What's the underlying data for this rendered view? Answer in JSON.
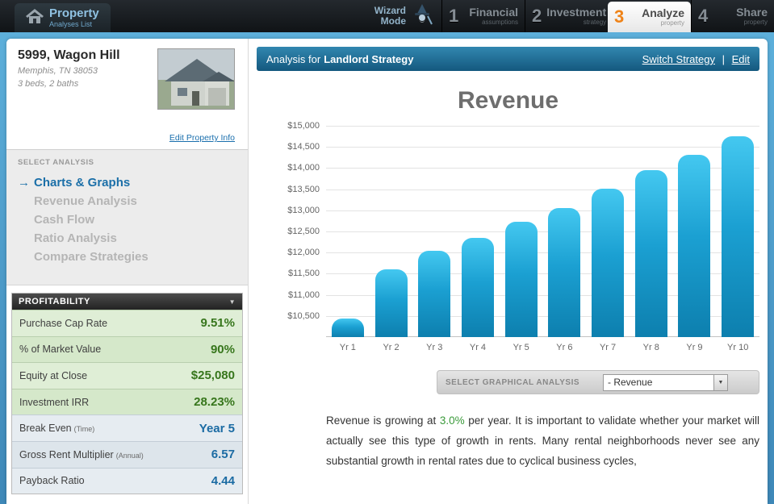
{
  "topbar": {
    "property_tab": {
      "label": "Property",
      "sublabel": "Analyses List"
    },
    "wizard_line1": "Wizard",
    "wizard_line2": "Mode",
    "steps": [
      {
        "num": "1",
        "label": "Financial",
        "sublabel": "assumptions",
        "active": false
      },
      {
        "num": "2",
        "label": "Investment",
        "sublabel": "strategy",
        "active": false
      },
      {
        "num": "3",
        "label": "Analyze",
        "sublabel": "property",
        "active": true
      },
      {
        "num": "4",
        "label": "Share",
        "sublabel": "property",
        "active": false
      }
    ]
  },
  "sidebar": {
    "property": {
      "title": "5999, Wagon Hill",
      "address": "Memphis, TN 38053",
      "details": "3 beds, 2 baths",
      "edit_link": "Edit Property Info"
    },
    "select_analysis": {
      "header": "SELECT ANALYSIS",
      "arrow": "→",
      "items": [
        {
          "label": "Charts & Graphs",
          "active": true
        },
        {
          "label": "Revenue Analysis",
          "active": false
        },
        {
          "label": "Cash Flow",
          "active": false
        },
        {
          "label": "Ratio Analysis",
          "active": false
        },
        {
          "label": "Compare Strategies",
          "active": false
        }
      ]
    },
    "profitability": {
      "header": "PROFITABILITY",
      "caret": "▼",
      "rows": [
        {
          "label": "Purchase Cap Rate",
          "sublabel": "",
          "value": "9.51%",
          "style": "green"
        },
        {
          "label": "% of Market Value",
          "sublabel": "",
          "value": "90%",
          "style": "green"
        },
        {
          "label": "Equity at Close",
          "sublabel": "",
          "value": "$25,080",
          "style": "green"
        },
        {
          "label": "Investment IRR",
          "sublabel": "",
          "value": "28.23%",
          "style": "green"
        },
        {
          "label": "Break Even",
          "sublabel": "(Time)",
          "value": "Year 5",
          "style": "blue"
        },
        {
          "label": "Gross Rent Multiplier",
          "sublabel": "(Annual)",
          "value": "6.57",
          "style": "blue"
        },
        {
          "label": "Payback Ratio",
          "sublabel": "",
          "value": "4.44",
          "style": "blue"
        }
      ]
    }
  },
  "main": {
    "header": {
      "prefix": "Analysis for ",
      "strategy": "Landlord Strategy",
      "switch_link": "Switch Strategy",
      "separator": "|",
      "edit_link": "Edit"
    },
    "select_graphical": {
      "label": "SELECT GRAPHICAL ANALYSIS",
      "dropdown_value": "- Revenue",
      "dropdown_caret": "▼"
    },
    "paragraph": {
      "part1": "Revenue is growing at ",
      "highlight": "3.0%",
      "part2": " per year. It is important to validate whether your market will actually see this type of growth in rents. Many rental neighborhoods never see any substantial growth in rental rates due to cyclical business cycles,"
    }
  },
  "chart_data": {
    "type": "bar",
    "title": "Revenue",
    "categories": [
      "Yr 1",
      "Yr 2",
      "Yr 3",
      "Yr 4",
      "Yr 5",
      "Yr 6",
      "Yr 7",
      "Yr 8",
      "Yr 9",
      "Yr 10"
    ],
    "values": [
      10430,
      11600,
      12050,
      12350,
      12720,
      13060,
      13520,
      13950,
      14320,
      14760
    ],
    "ylim": [
      10000,
      15000
    ],
    "ytick_step": 500,
    "ytick_labels": [
      "$15,000",
      "$14,500",
      "$14,000",
      "$13,500",
      "$13,000",
      "$12,500",
      "$12,000",
      "$11,500",
      "$11,000",
      "$10,500"
    ],
    "xlabel": "",
    "ylabel": "",
    "grid": true,
    "legend": "none",
    "bar_color_top": "#44c8f0",
    "bar_color_bottom": "#0d7fae"
  }
}
